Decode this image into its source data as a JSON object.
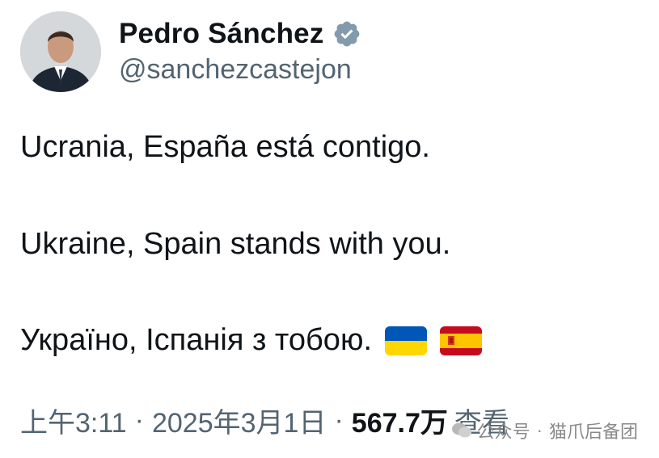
{
  "author": {
    "display_name": "Pedro Sánchez",
    "handle": "@sanchezcastejon",
    "verified_icon": "verified-badge-icon",
    "avatar_icon": "profile-photo"
  },
  "tweet": {
    "line1": "Ucrania, España está contigo.",
    "line2": "Ukraine, Spain stands with you.",
    "line3": "Україно, Іспанія з тобою.",
    "emoji": [
      "flag-ukraine-icon",
      "flag-spain-icon"
    ]
  },
  "meta": {
    "time": "上午3:11",
    "separator": "·",
    "date": "2025年3月1日",
    "views_count": "567.7万",
    "views_label": "查看"
  },
  "watermark": {
    "platform": "公众号",
    "separator": "·",
    "account": "猫爪后备团"
  },
  "colors": {
    "text": "#0f1419",
    "secondary": "#536471",
    "verified_badge": "#829aab",
    "ukraine_blue": "#0057b7",
    "ukraine_yellow": "#ffd700",
    "spain_red": "#c60b1e",
    "spain_yellow": "#ffc400"
  }
}
